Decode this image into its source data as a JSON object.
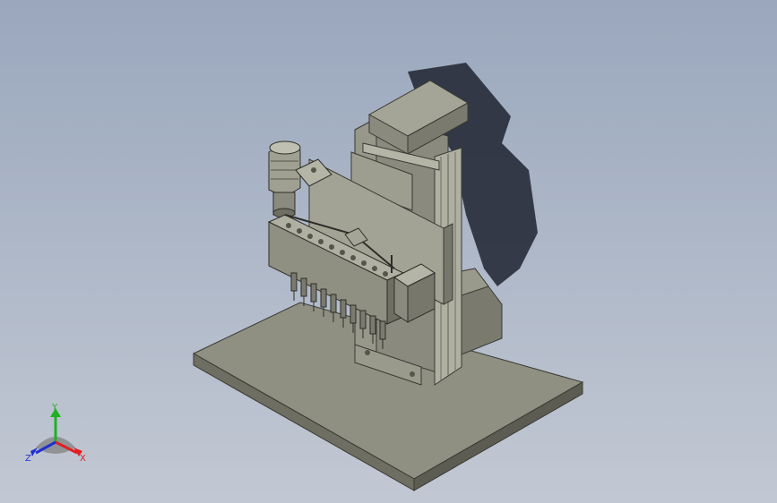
{
  "view": {
    "background_top": "#9aa7bd",
    "background_bottom": "#c2c8d3",
    "model_color": "#8f8f82"
  },
  "triad": {
    "x_label": "X",
    "y_label": "Y",
    "z_label": "Z",
    "x_color": "#e02020",
    "y_color": "#20b020",
    "z_color": "#2030d0"
  }
}
